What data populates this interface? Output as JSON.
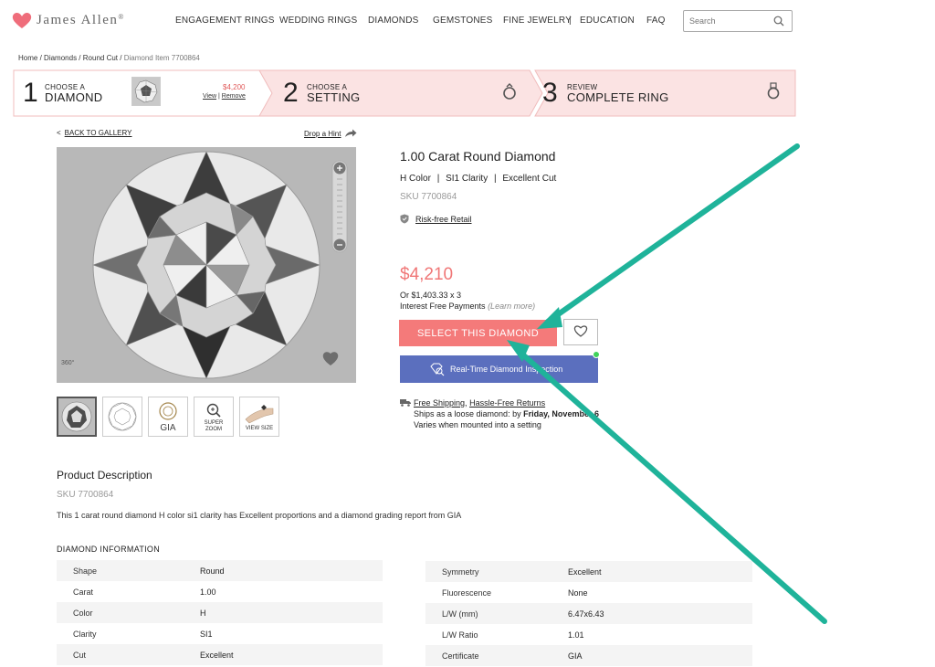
{
  "brand": {
    "name": "James Allen",
    "reg": "®"
  },
  "nav": [
    "ENGAGEMENT RINGS",
    "WEDDING RINGS",
    "DIAMONDS",
    "GEMSTONES",
    "FINE JEWELRY",
    "|",
    "EDUCATION",
    "FAQ"
  ],
  "search": {
    "placeholder": "Search"
  },
  "breadcrumb": {
    "home": "Home",
    "diamonds": "Diamonds",
    "round": "Round Cut",
    "item": "Diamond Item 7700864",
    "sep": "/"
  },
  "steps": {
    "s1": {
      "num": "1",
      "small": "CHOOSE A",
      "big": "DIAMOND",
      "price": "$4,200",
      "view": "View",
      "pipe": "|",
      "remove": "Remove"
    },
    "s2": {
      "num": "2",
      "small": "CHOOSE A",
      "big": "SETTING"
    },
    "s3": {
      "num": "3",
      "small": "REVIEW",
      "big": "COMPLETE RING"
    }
  },
  "gallery": {
    "back": "BACK TO GALLERY",
    "back_arrow": "<",
    "hint": "Drop a Hint",
    "badge_360": "360°"
  },
  "thumbs": {
    "gia": "GIA",
    "super": "SUPER",
    "zoom": "ZOOM",
    "view_size": "VIEW SIZE"
  },
  "product": {
    "title": "1.00 Carat Round Diamond",
    "color": "H Color",
    "clarity": "SI1 Clarity",
    "cut": "Excellent Cut",
    "sep": "|",
    "sku": "SKU 7700864",
    "risk": "Risk-free Retail",
    "price": "$4,210",
    "monthly": "Or $1,403.33 x 3",
    "interest": "Interest Free Payments",
    "learn": "(Learn more)",
    "select_label": "SELECT THIS DIAMOND",
    "inspect_label": "Real-Time Diamond Inspection",
    "shipping": "Free Shipping",
    "returns": "Hassle-Free Returns",
    "ship_comma": ",",
    "ships_prefix": "Ships as a loose diamond: by",
    "ships_date": "Friday, November 6",
    "varies": "Varies when mounted into a setting"
  },
  "description": {
    "title": "Product Description",
    "sku": "SKU 7700864",
    "text": "This 1 carat round diamond H color si1 clarity has Excellent proportions and a diamond grading report from GIA"
  },
  "info": {
    "title": "DIAMOND INFORMATION",
    "left": [
      {
        "k": "Shape",
        "v": "Round"
      },
      {
        "k": "Carat",
        "v": "1.00"
      },
      {
        "k": "Color",
        "v": "H"
      },
      {
        "k": "Clarity",
        "v": "SI1"
      },
      {
        "k": "Cut",
        "v": "Excellent"
      }
    ],
    "right": [
      {
        "k": "Symmetry",
        "v": "Excellent"
      },
      {
        "k": "Fluorescence",
        "v": "None"
      },
      {
        "k": "L/W (mm)",
        "v": "6.47x6.43"
      },
      {
        "k": "L/W Ratio",
        "v": "1.01"
      },
      {
        "k": "Certificate",
        "v": "GIA"
      }
    ]
  },
  "colors": {
    "accent": "#f47a7a",
    "price": "#f07777",
    "inspect": "#5b6fbe",
    "annotation": "#1fb39a",
    "dot": "#3fd25a"
  }
}
